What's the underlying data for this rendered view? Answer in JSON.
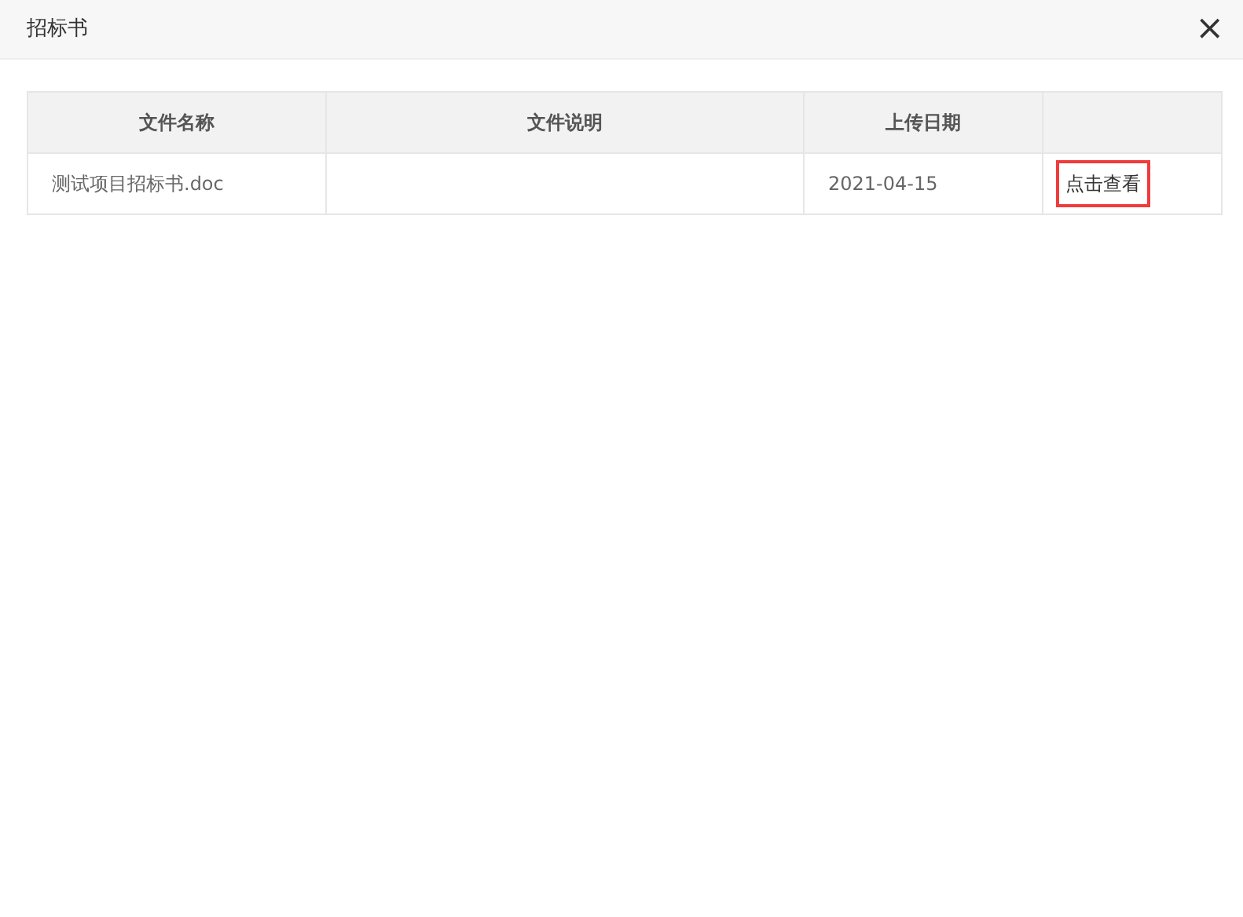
{
  "dialog": {
    "title": "招标书",
    "close": "×"
  },
  "table": {
    "columns": [
      {
        "label": "文件名称"
      },
      {
        "label": "文件说明"
      },
      {
        "label": "上传日期"
      }
    ],
    "rows": [
      {
        "file_name": "测试项目招标书.doc",
        "upload_date": "2021-04-15",
        "action": {
          "label": "点击查看",
          "highlighted": true
        }
      }
    ]
  }
}
